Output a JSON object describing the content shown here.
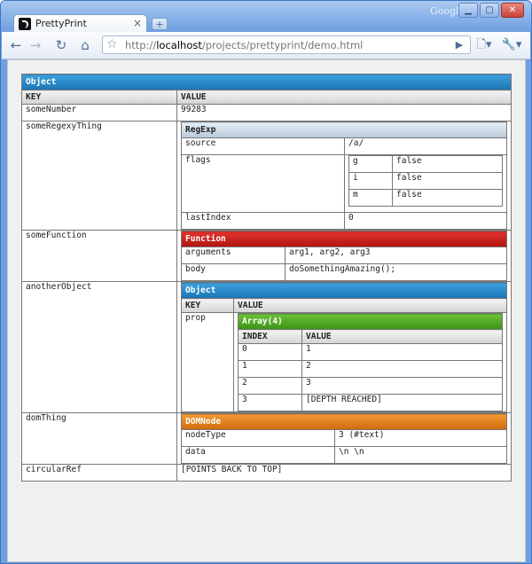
{
  "browser": {
    "tab_title": "PrettyPrint",
    "tab_close": "×",
    "new_tab": "+",
    "brand": "Google",
    "url_prefix": "http://",
    "url_host": "localhost",
    "url_path": "/projects/prettyprint/demo.html",
    "window_controls": [
      "minimize-icon",
      "maximize-icon",
      "close-icon"
    ],
    "nav_icons": [
      "back-arrow-icon",
      "forward-arrow-icon",
      "reload-icon",
      "home-icon",
      "star-icon",
      "go-icon",
      "page-menu-icon",
      "wrench-icon"
    ]
  },
  "root": {
    "title": "Object",
    "key_header": "KEY",
    "value_header": "VALUE",
    "rows": [
      {
        "key": "someNumber",
        "value": "99283"
      },
      {
        "key": "someRegexyThing"
      },
      {
        "key": "someFunction"
      },
      {
        "key": "anotherObject"
      },
      {
        "key": "domThing"
      },
      {
        "key": "circularRef",
        "value": "[POINTS BACK TO TOP]"
      }
    ]
  },
  "regexp": {
    "title": "RegExp",
    "source_key": "source",
    "source_value": "/a/",
    "flags_key": "flags",
    "flags": [
      {
        "key": "g",
        "value": "false"
      },
      {
        "key": "i",
        "value": "false"
      },
      {
        "key": "m",
        "value": "false"
      }
    ],
    "lastindex_key": "lastIndex",
    "lastindex_value": "0"
  },
  "function": {
    "title": "Function",
    "arguments_key": "arguments",
    "arguments_value": "arg1, arg2, arg3",
    "body_key": "body",
    "body_value": "doSomethingAmazing();"
  },
  "another_object": {
    "title": "Object",
    "key_header": "KEY",
    "value_header": "VALUE",
    "prop_key": "prop",
    "array": {
      "title": "Array(4)",
      "index_header": "INDEX",
      "value_header": "VALUE",
      "items": [
        {
          "index": "0",
          "value": "1"
        },
        {
          "index": "1",
          "value": "2"
        },
        {
          "index": "2",
          "value": "3"
        },
        {
          "index": "3",
          "value": "[DEPTH REACHED]"
        }
      ]
    }
  },
  "domnode": {
    "title": "DOMNode",
    "nodetype_key": "nodeType",
    "nodetype_value": "3 (#text)",
    "data_key": "data",
    "data_value": "\\n \\n"
  },
  "colors": {
    "object": "#1a84c8",
    "regexp": "#cfdce8",
    "function": "#c71f19",
    "array": "#4ea526",
    "domnode": "#e07d14"
  }
}
